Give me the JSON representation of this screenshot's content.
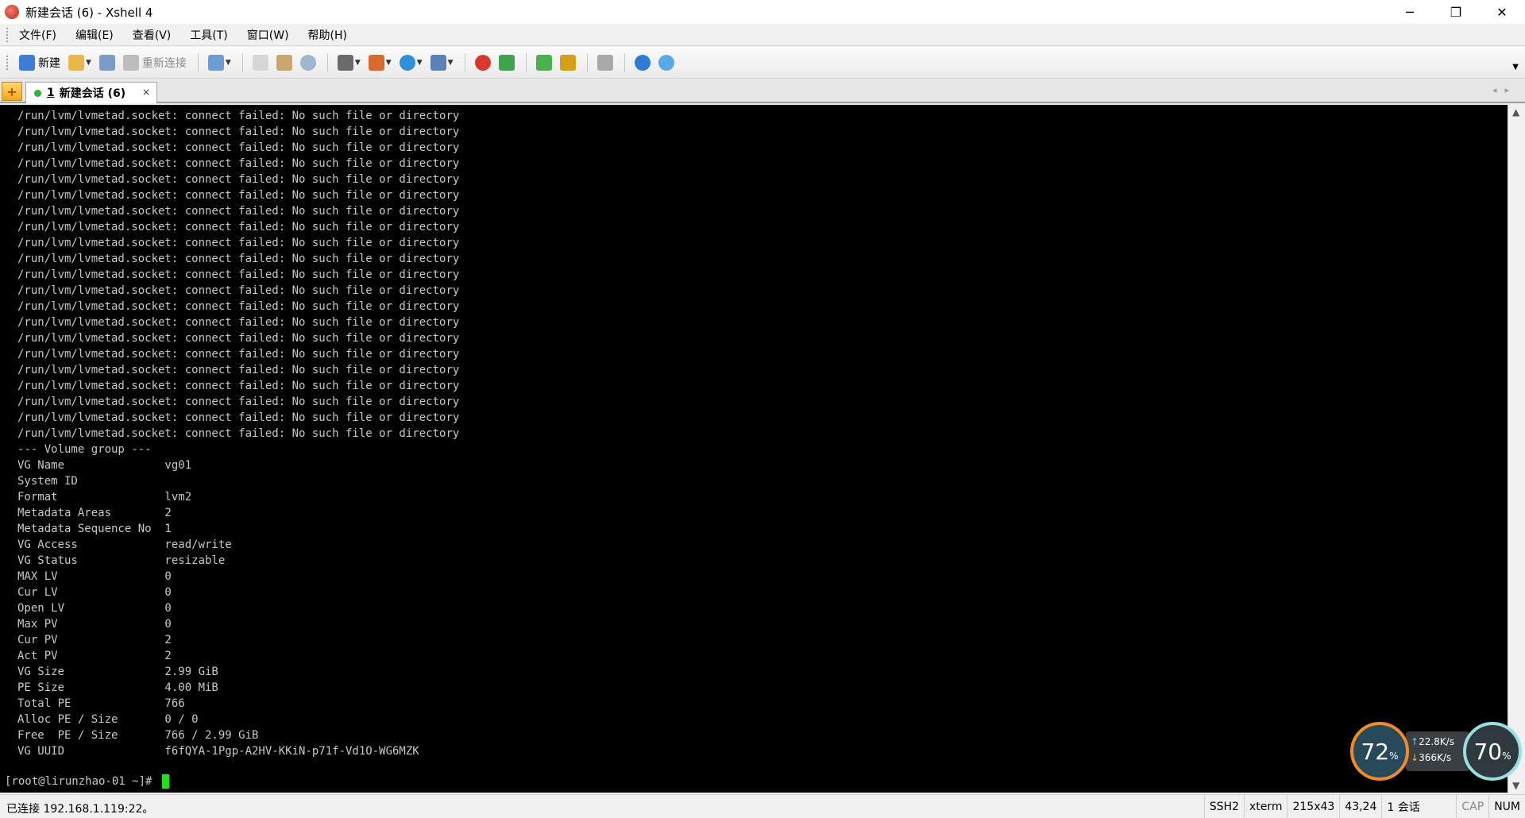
{
  "window": {
    "title": "新建会话 (6) - Xshell 4",
    "minimize": "─",
    "maximize": "❐",
    "close": "✕"
  },
  "menu": [
    "文件(F)",
    "编辑(E)",
    "查看(V)",
    "工具(T)",
    "窗口(W)",
    "帮助(H)"
  ],
  "toolbar": {
    "new_label": "新建",
    "reconnect_label": "重新连接"
  },
  "tabs": {
    "new_tab_symbol": "+",
    "active": {
      "number": "1",
      "label": "新建会话 (6)",
      "close": "×"
    },
    "nav": "◂▸"
  },
  "terminal": {
    "error_line": "/run/lvm/lvmetad.socket: connect failed: No such file or directory",
    "error_count": 21,
    "header": "  --- Volume group ---",
    "fields": [
      [
        "VG Name",
        "vg01"
      ],
      [
        "System ID",
        ""
      ],
      [
        "Format",
        "lvm2"
      ],
      [
        "Metadata Areas",
        "2"
      ],
      [
        "Metadata Sequence No",
        "1"
      ],
      [
        "VG Access",
        "read/write"
      ],
      [
        "VG Status",
        "resizable"
      ],
      [
        "MAX LV",
        "0"
      ],
      [
        "Cur LV",
        "0"
      ],
      [
        "Open LV",
        "0"
      ],
      [
        "Max PV",
        "0"
      ],
      [
        "Cur PV",
        "2"
      ],
      [
        "Act PV",
        "2"
      ],
      [
        "VG Size",
        "2.99 GiB"
      ],
      [
        "PE Size",
        "4.00 MiB"
      ],
      [
        "Total PE",
        "766"
      ],
      [
        "Alloc PE / Size",
        "0 / 0"
      ],
      [
        "Free  PE / Size",
        "766 / 2.99 GiB"
      ],
      [
        "VG UUID",
        "f6fQYA-1Pgp-A2HV-KKiN-p71f-Vd1O-WG6MZK"
      ]
    ],
    "prompt": "[root@lirunzhao-01 ~]# "
  },
  "widget": {
    "left_percent": "72",
    "right_percent": "70",
    "percent_sign": "%",
    "upload": "22.8",
    "download": "366",
    "rate_unit": "K/s",
    "ring_left_color": "#f08b2c",
    "ring_right_color": "#9adfe0"
  },
  "status": {
    "connection": "已连接 192.168.1.119:22。",
    "protocol": "SSH2",
    "term": "xterm",
    "size": "215x43",
    "cursor": "43,24",
    "sessions": "1 会话",
    "cap": "CAP",
    "num": "NUM"
  }
}
